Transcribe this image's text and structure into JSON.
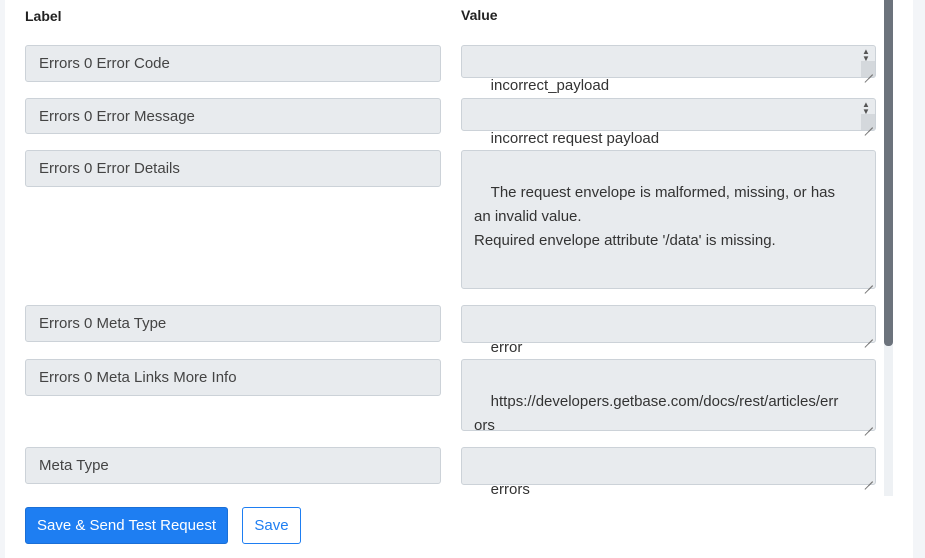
{
  "headers": {
    "label": "Label",
    "value": "Value"
  },
  "rows": [
    {
      "label": "Errors 0 Error Code",
      "value": "incorrect_payload"
    },
    {
      "label": "Errors 0 Error Message",
      "value": "incorrect request payload"
    },
    {
      "label": "Errors 0 Error Details",
      "value": "The request envelope is malformed, missing, or has an invalid value.\nRequired envelope attribute '/data' is missing."
    },
    {
      "label": "Errors 0 Meta Type",
      "value": "error"
    },
    {
      "label": "Errors 0 Meta Links More Info",
      "value": "https://developers.getbase.com/docs/rest/articles/errors"
    },
    {
      "label": "Meta Type",
      "value": "errors"
    }
  ],
  "buttons": {
    "save_send": "Save & Send Test Request",
    "save": "Save"
  }
}
